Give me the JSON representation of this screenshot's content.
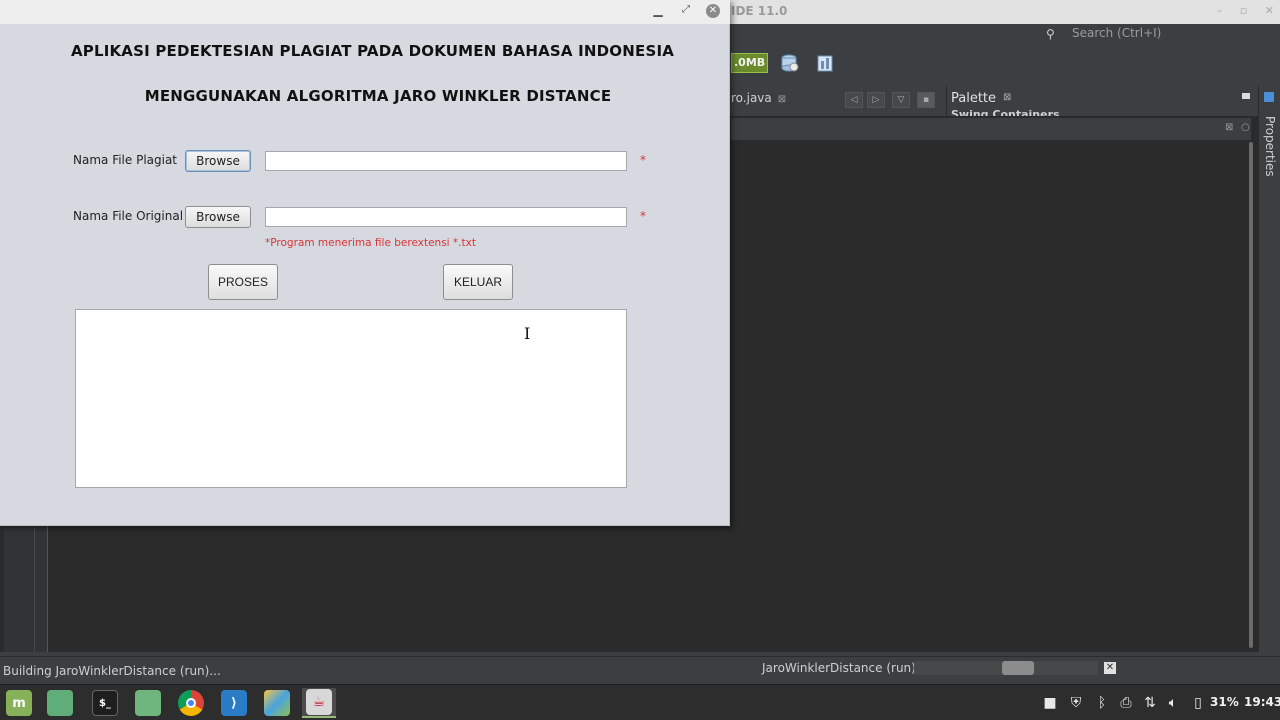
{
  "ide": {
    "title_fragment": "IDE 11.0",
    "memory_badge": ".0MB",
    "search_placeholder": "Search (Ctrl+I)",
    "editor_tab": "ro.java",
    "palette_title": "Palette",
    "palette_sub": "Swing Containers",
    "properties_label": "Properties",
    "status_left": "Building JaroWinklerDistance (run)...",
    "status_task": "JaroWinklerDistance (run)",
    "progress_fraction": 0.58
  },
  "app": {
    "heading_line1": "APLIKASI PEDEKTESIAN PLAGIAT PADA DOKUMEN BAHASA INDONESIA",
    "heading_line2": "MENGGUNAKAN ALGORITMA JARO WINKLER DISTANCE",
    "row_plagiat": {
      "label": "Nama File Plagiat",
      "button": "Browse",
      "value": "",
      "required": "*"
    },
    "row_original": {
      "label": "Nama File Original",
      "button": "Browse",
      "value": "",
      "required": "*"
    },
    "hint": "*Program menerima file berextensi  *.txt",
    "process_button": "PROSES",
    "exit_button": "KELUAR",
    "result_text": ""
  },
  "taskbar": {
    "apps": [
      "mint-menu-icon",
      "show-desktop-icon",
      "terminal-icon",
      "files-icon",
      "chrome-icon",
      "vscode-icon",
      "netbeans-icon",
      "java-app-icon"
    ],
    "battery": "31%",
    "clock": "19:43"
  }
}
